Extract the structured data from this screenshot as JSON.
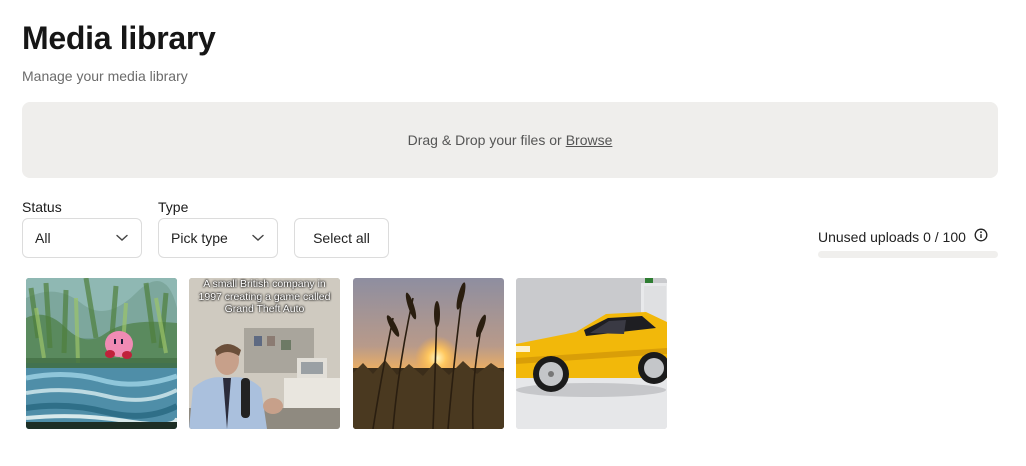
{
  "header": {
    "title": "Media library",
    "subtitle": "Manage your media library"
  },
  "dropzone": {
    "text": "Drag & Drop your files or",
    "browse_label": "Browse"
  },
  "filters": {
    "status_label": "Status",
    "status_value": "All",
    "type_label": "Type",
    "type_value": "Pick type",
    "select_all_label": "Select all"
  },
  "usage": {
    "text": "Unused uploads 0 / 100",
    "used": 0,
    "limit": 100
  },
  "media": [
    {
      "kind": "image",
      "subject": "kirby-painting"
    },
    {
      "kind": "video",
      "subject": "office-man",
      "caption": "A small British company in 1997 creating a game called Grand Theft Auto"
    },
    {
      "kind": "image",
      "subject": "sunset-grass"
    },
    {
      "kind": "image",
      "subject": "yellow-car"
    }
  ],
  "colors": {
    "dropzone_bg": "#efeeec",
    "border": "#dcdcdc",
    "muted_text": "#6b6b6b"
  }
}
